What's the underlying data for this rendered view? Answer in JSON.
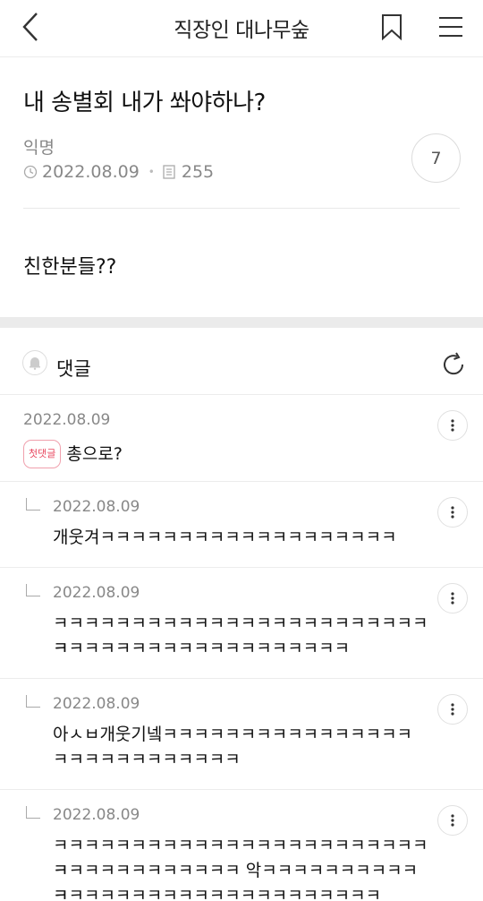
{
  "header": {
    "title": "직장인 대나무숲"
  },
  "post": {
    "title": "내 송별회 내가 쏴야하나?",
    "author": "익명",
    "date": "2022.08.09",
    "views": "255",
    "comment_count": "7",
    "body": "친한분들??"
  },
  "comments_section": {
    "label": "댓글"
  },
  "comments": [
    {
      "date": "2022.08.09",
      "badge": "첫댓글",
      "text": "총으로?"
    },
    {
      "date": "2022.08.09",
      "text": "개웃겨ㅋㅋㅋㅋㅋㅋㅋㅋㅋㅋㅋㅋㅋㅋㅋㅋㅋㅋㅋ"
    },
    {
      "date": "2022.08.09",
      "line1": "ㅋㅋㅋㅋㅋㅋㅋㅋㅋㅋㅋㅋㅋㅋㅋㅋㅋㅋㅋㅋㅋㅋㅋㅋㅋ",
      "line2": "ㅋㅋㅋㅋㅋㅋㅋㅋㅋㅋㅋㅋㅋㅋㅋㅋㅋㅋㅋ"
    },
    {
      "date": "2022.08.09",
      "line1": "아ㅅㅂ개웃기넼ㅋㅋㅋㅋㅋㅋㅋㅋㅋㅋㅋㅋㅋㅋㅋㅋ",
      "line2": "ㅋㅋㅋㅋㅋㅋㅋㅋㅋㅋㅋㅋ"
    },
    {
      "date": "2022.08.09",
      "line1": "ㅋㅋㅋㅋㅋㅋㅋㅋㅋㅋㅋㅋㅋㅋㅋㅋㅋㅋㅋㅋㅋㅋㅋㅋㅋ",
      "line2": "ㅋㅋㅋㅋㅋㅋㅋㅋㅋㅋㅋㅋ 악ㅋㅋㅋㅋㅋㅋㅋㅋㅋㅋㅋ",
      "line3": "ㅋㅋㅋㅋㅋㅋㅋㅋㅋㅋㅋㅋㅋㅋㅋㅋㅋㅋㅋㅋㅋ"
    }
  ],
  "icons": {
    "back": "chevron-left-icon",
    "bookmark": "bookmark-icon",
    "menu": "hamburger-menu-icon",
    "clock": "clock-icon",
    "views": "document-icon",
    "bell": "bell-icon",
    "refresh": "refresh-icon",
    "more": "more-vertical-icon",
    "reply": "reply-arrow-icon"
  },
  "colors": {
    "badge": "#e8475f",
    "meta_text": "#888888",
    "separator": "#ebebeb"
  }
}
